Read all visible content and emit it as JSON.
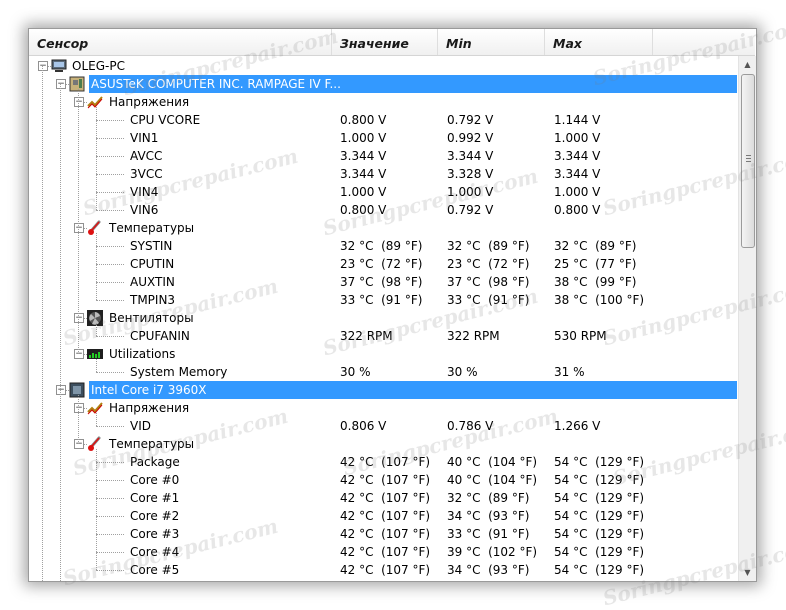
{
  "columns": [
    "Сенсор",
    "Значение",
    "Min",
    "Max"
  ],
  "watermark": "Soringpcrepair.com",
  "tree": [
    {
      "level": 0,
      "label": "OLEG-PC",
      "icon": "computer-icon",
      "expander": "−"
    },
    {
      "level": 1,
      "label": "ASUSTeK COMPUTER INC. RAMPAGE IV F...",
      "icon": "motherboard-icon",
      "expander": "−",
      "selected": true
    },
    {
      "level": 2,
      "label": "Напряжения",
      "icon": "voltage-icon",
      "expander": "−"
    },
    {
      "level": 3,
      "label": "CPU VCORE",
      "value": "0.800 V",
      "min": "0.792 V",
      "max": "1.144 V"
    },
    {
      "level": 3,
      "label": "VIN1",
      "value": "1.000 V",
      "min": "0.992 V",
      "max": "1.000 V"
    },
    {
      "level": 3,
      "label": "AVCC",
      "value": "3.344 V",
      "min": "3.344 V",
      "max": "3.344 V"
    },
    {
      "level": 3,
      "label": "3VCC",
      "value": "3.344 V",
      "min": "3.328 V",
      "max": "3.344 V"
    },
    {
      "level": 3,
      "label": "VIN4",
      "value": "1.000 V",
      "min": "1.000 V",
      "max": "1.000 V"
    },
    {
      "level": 3,
      "label": "VIN6",
      "value": "0.800 V",
      "min": "0.792 V",
      "max": "0.800 V"
    },
    {
      "level": 2,
      "label": "Температуры",
      "icon": "thermometer-icon",
      "expander": "−"
    },
    {
      "level": 3,
      "label": "SYSTIN",
      "value": "32 °C  (89 °F)",
      "min": "32 °C  (89 °F)",
      "max": "32 °C  (89 °F)"
    },
    {
      "level": 3,
      "label": "CPUTIN",
      "value": "23 °C  (72 °F)",
      "min": "23 °C  (72 °F)",
      "max": "25 °C  (77 °F)"
    },
    {
      "level": 3,
      "label": "AUXTIN",
      "value": "37 °C  (98 °F)",
      "min": "37 °C  (98 °F)",
      "max": "38 °C  (99 °F)"
    },
    {
      "level": 3,
      "label": "TMPIN3",
      "value": "33 °C  (91 °F)",
      "min": "33 °C  (91 °F)",
      "max": "38 °C  (100 °F)"
    },
    {
      "level": 2,
      "label": "Вентиляторы",
      "icon": "fan-icon",
      "expander": "−"
    },
    {
      "level": 3,
      "label": "CPUFANIN",
      "value": "322 RPM",
      "min": "322 RPM",
      "max": "530 RPM"
    },
    {
      "level": 2,
      "label": "Utilizations",
      "icon": "utilization-icon",
      "expander": "−"
    },
    {
      "level": 3,
      "label": "System Memory",
      "value": "30 %",
      "min": "30 %",
      "max": "31 %"
    },
    {
      "level": 1,
      "label": "Intel Core i7 3960X",
      "icon": "cpu-icon",
      "expander": "−",
      "selected": true
    },
    {
      "level": 2,
      "label": "Напряжения",
      "icon": "voltage-icon",
      "expander": "−"
    },
    {
      "level": 3,
      "label": "VID",
      "value": "0.806 V",
      "min": "0.786 V",
      "max": "1.266 V"
    },
    {
      "level": 2,
      "label": "Температуры",
      "icon": "thermometer-icon",
      "expander": "−"
    },
    {
      "level": 3,
      "label": "Package",
      "value": "42 °C  (107 °F)",
      "min": "40 °C  (104 °F)",
      "max": "54 °C  (129 °F)"
    },
    {
      "level": 3,
      "label": "Core #0",
      "value": "42 °C  (107 °F)",
      "min": "40 °C  (104 °F)",
      "max": "54 °C  (129 °F)"
    },
    {
      "level": 3,
      "label": "Core #1",
      "value": "42 °C  (107 °F)",
      "min": "32 °C  (89 °F)",
      "max": "54 °C  (129 °F)"
    },
    {
      "level": 3,
      "label": "Core #2",
      "value": "42 °C  (107 °F)",
      "min": "34 °C  (93 °F)",
      "max": "54 °C  (129 °F)"
    },
    {
      "level": 3,
      "label": "Core #3",
      "value": "42 °C  (107 °F)",
      "min": "33 °C  (91 °F)",
      "max": "54 °C  (129 °F)"
    },
    {
      "level": 3,
      "label": "Core #4",
      "value": "42 °C  (107 °F)",
      "min": "39 °C  (102 °F)",
      "max": "54 °C  (129 °F)"
    },
    {
      "level": 3,
      "label": "Core #5",
      "value": "42 °C  (107 °F)",
      "min": "34 °C  (93 °F)",
      "max": "54 °C  (129 °F)"
    }
  ],
  "scrollbar": {
    "up_arrow": "▲",
    "down_arrow": "▼"
  }
}
